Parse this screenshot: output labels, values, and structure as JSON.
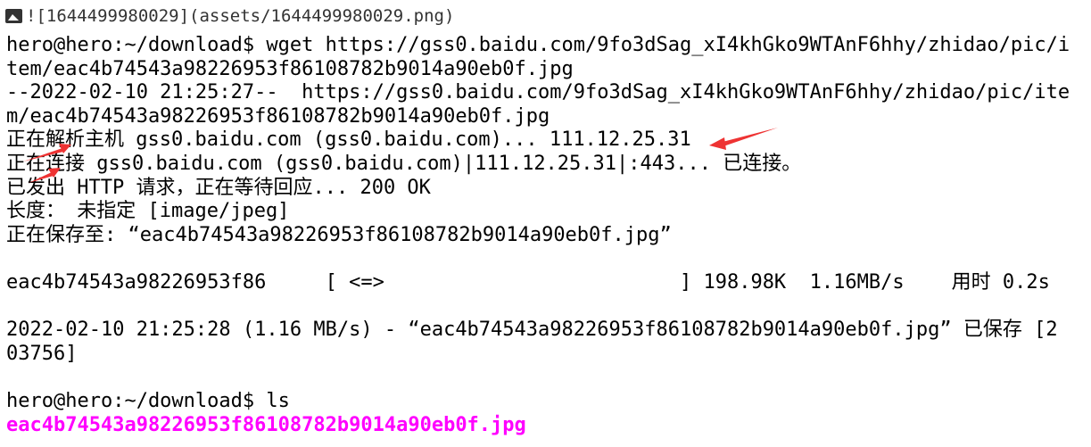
{
  "header": {
    "icon": "image-icon",
    "markdown_text": "![1644499980029](assets/1644499980029.png)"
  },
  "terminal": {
    "lines": [
      "hero@hero:~/download$ wget https://gss0.baidu.com/9fo3dSag_xI4khGko9WTAnF6hhy/zhidao/pic/i",
      "tem/eac4b74543a98226953f86108782b9014a90eb0f.jpg",
      "--2022-02-10 21:25:27--  https://gss0.baidu.com/9fo3dSag_xI4khGko9WTAnF6hhy/zhidao/pic/ite",
      "m/eac4b74543a98226953f86108782b9014a90eb0f.jpg",
      "正在解析主机 gss0.baidu.com (gss0.baidu.com)... 111.12.25.31",
      "正在连接 gss0.baidu.com (gss0.baidu.com)|111.12.25.31|:443... 已连接。",
      "已发出 HTTP 请求，正在等待回应... 200 OK",
      "长度： 未指定 [image/jpeg]",
      "正在保存至: “eac4b74543a98226953f86108782b9014a90eb0f.jpg”",
      "",
      "eac4b74543a98226953f86     [ <=>                         ] 198.98K  1.16MB/s    用时 0.2s",
      "",
      "2022-02-10 21:25:28 (1.16 MB/s) - “eac4b74543a98226953f86108782b9014a90eb0f.jpg” 已保存 [2",
      "03756]",
      "",
      "hero@hero:~/download$ ls"
    ],
    "ls_output": "eac4b74543a98226953f86108782b9014a90eb0f.jpg"
  },
  "colors": {
    "text": "#000000",
    "ls_file": "#ff00ff",
    "arrow": "#ee3333"
  }
}
